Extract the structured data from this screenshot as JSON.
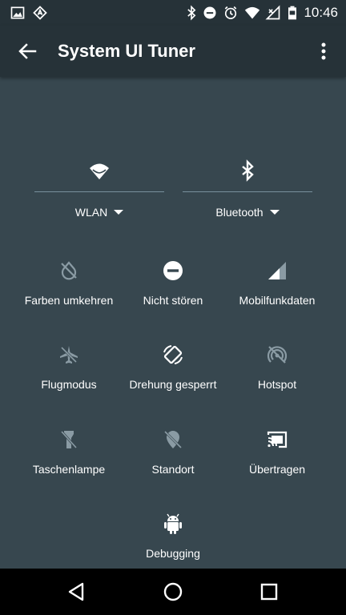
{
  "status_bar": {
    "time": "10:46",
    "left_icons": [
      "image-notification-icon",
      "app-notification-icon"
    ],
    "right_icons": [
      "bluetooth-status-icon",
      "do-not-disturb-status-icon",
      "alarm-status-icon",
      "wifi-status-icon",
      "mobile-signal-status-icon",
      "battery-status-icon"
    ]
  },
  "app_bar": {
    "title": "System UI Tuner",
    "back_icon": "arrow-back-icon",
    "overflow_icon": "more-vert-icon"
  },
  "top_tiles": [
    {
      "label": "WLAN",
      "icon": "wifi-icon"
    },
    {
      "label": "Bluetooth",
      "icon": "bluetooth-icon"
    }
  ],
  "tiles": [
    {
      "label": "Farben umkehren",
      "icon": "invert-colors-off-icon",
      "active": false
    },
    {
      "label": "Nicht stören",
      "icon": "do-not-disturb-icon",
      "active": true
    },
    {
      "label": "Mobilfunkdaten",
      "icon": "cellular-signal-icon",
      "active": true
    },
    {
      "label": "Flugmodus",
      "icon": "airplane-icon",
      "active": false
    },
    {
      "label": "Drehung gesperrt",
      "icon": "rotation-lock-icon",
      "active": true
    },
    {
      "label": "Hotspot",
      "icon": "hotspot-off-icon",
      "active": false
    },
    {
      "label": "Taschenlampe",
      "icon": "flashlight-off-icon",
      "active": false
    },
    {
      "label": "Standort",
      "icon": "location-off-icon",
      "active": false
    },
    {
      "label": "Übertragen",
      "icon": "cast-icon",
      "active": true
    },
    {
      "label": "Debugging",
      "icon": "android-icon",
      "active": true
    }
  ],
  "colors": {
    "background": "#37474f",
    "app_bar": "#263238",
    "icon_active": "#ffffff",
    "icon_inactive": "#8a9ba4"
  },
  "nav_bar": [
    "nav-back-icon",
    "nav-home-icon",
    "nav-recents-icon"
  ]
}
